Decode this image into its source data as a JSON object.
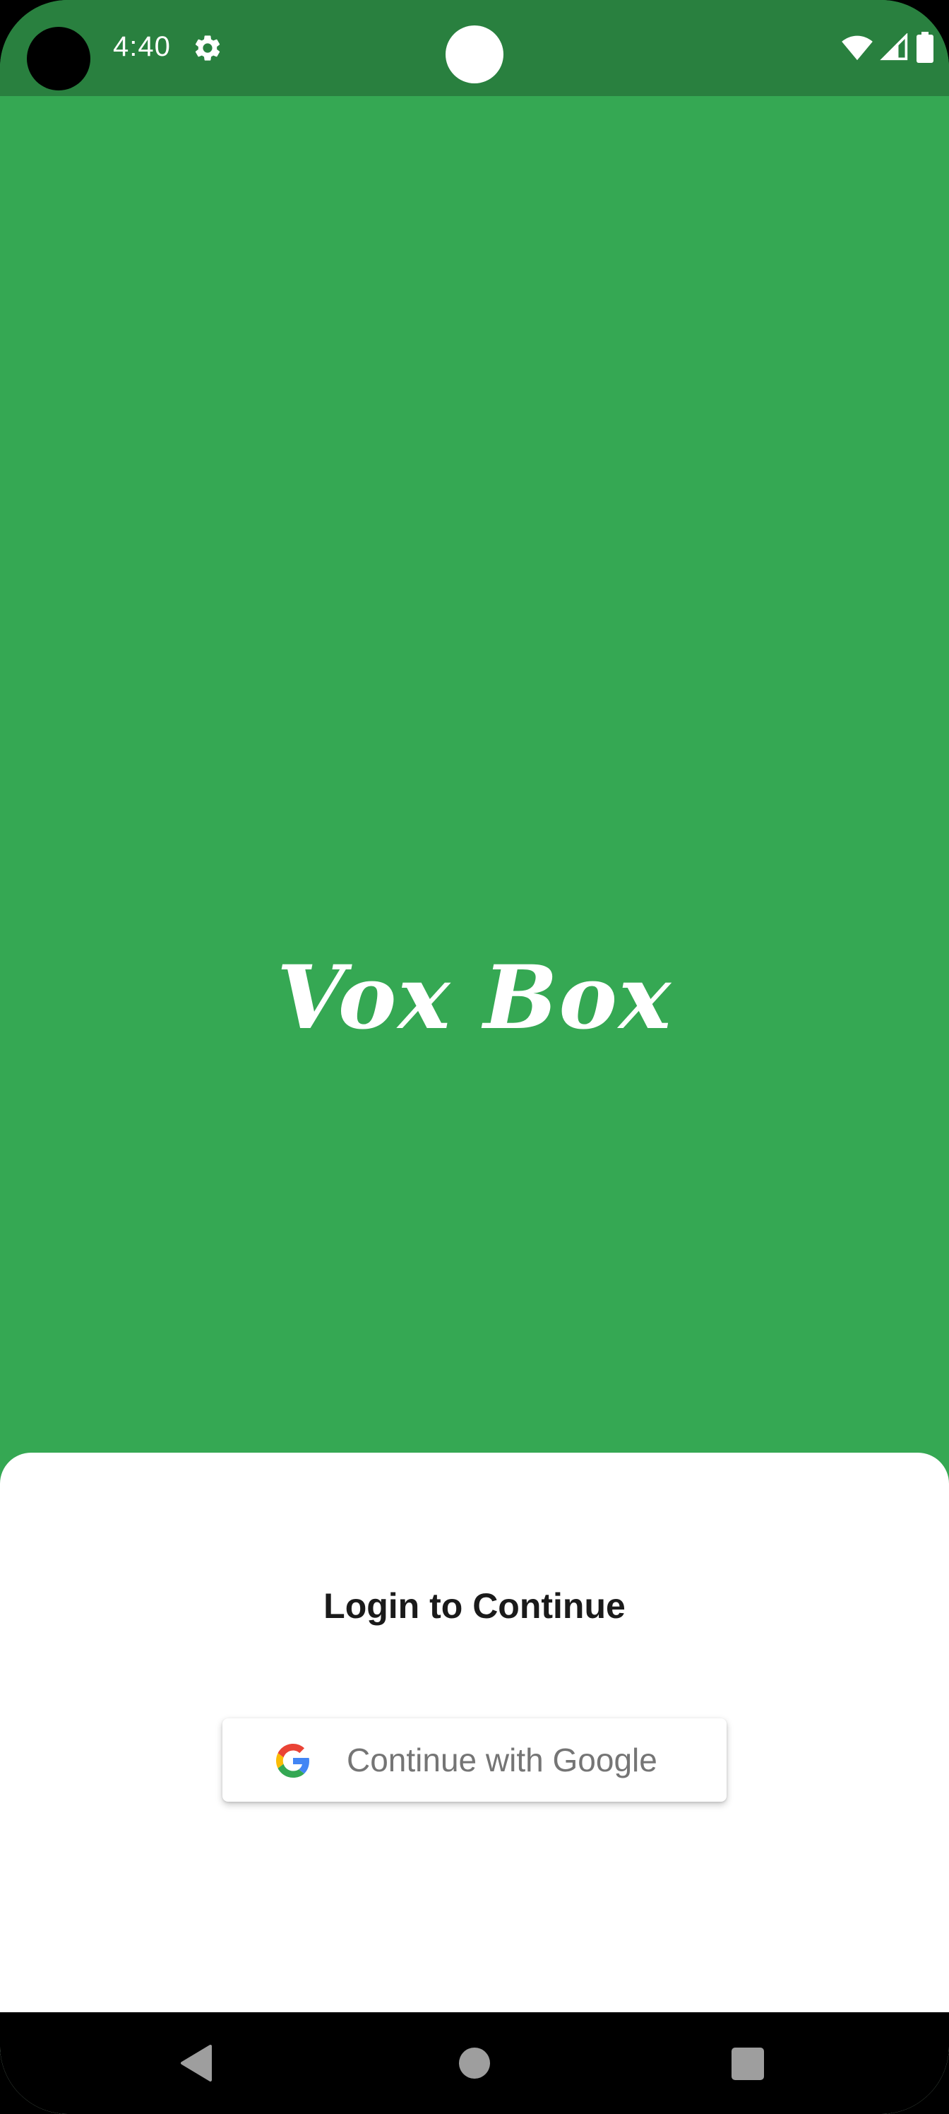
{
  "status_bar": {
    "time": "4:40",
    "icons": [
      "camera-cutout",
      "settings-gear-icon",
      "wifi-icon",
      "cell-signal-icon",
      "battery-icon"
    ]
  },
  "brand": {
    "title": "Vox Box",
    "background_color": "#35A853"
  },
  "login_sheet": {
    "title": "Login to Continue",
    "google_button_label": "Continue with Google",
    "google_icon": "google-g-icon"
  },
  "nav_bar": {
    "buttons": [
      "back-icon",
      "home-icon",
      "recents-icon"
    ]
  },
  "colors": {
    "status_bar": "#29803F",
    "primary_green": "#35A853",
    "sheet": "#FFFFFF",
    "button_text": "#757575"
  }
}
